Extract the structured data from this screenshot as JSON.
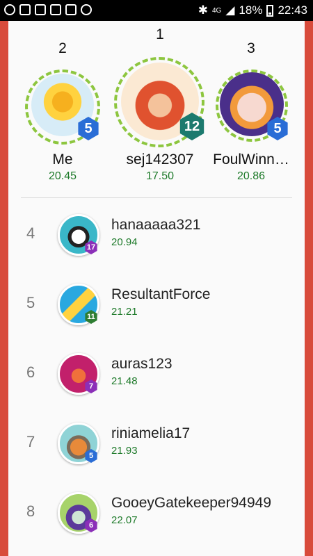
{
  "status_bar": {
    "battery": "18%",
    "time": "22:43",
    "network": "4G"
  },
  "podium": [
    {
      "rank": "2",
      "name": "Me",
      "time": "20.45",
      "level": "5",
      "avatar": "sunflower-avatar",
      "badge_color": "#2a6dd6"
    },
    {
      "rank": "1",
      "name": "sej142307",
      "time": "17.50",
      "level": "12",
      "avatar": "queen-of-clubs-avatar",
      "badge_color": "#1c7a6e"
    },
    {
      "rank": "3",
      "name": "FoulWinn…",
      "time": "20.86",
      "level": "5",
      "avatar": "unicorn-avatar",
      "badge_color": "#2a6dd6"
    }
  ],
  "list": [
    {
      "rank": "4",
      "name": "hanaaaaa321",
      "time": "20.94",
      "level": "17",
      "avatar": "robot-avatar",
      "badge_color": "#8b2fb8"
    },
    {
      "rank": "5",
      "name": "ResultantForce",
      "time": "21.21",
      "level": "11",
      "avatar": "paper-plane-avatar",
      "badge_color": "#2e7d32"
    },
    {
      "rank": "6",
      "name": "auras123",
      "time": "21.48",
      "level": "7",
      "avatar": "jar-monster-avatar",
      "badge_color": "#8b2fb8"
    },
    {
      "rank": "7",
      "name": "riniamelia17",
      "time": "21.93",
      "level": "5",
      "avatar": "viking-avatar",
      "badge_color": "#2a6dd6"
    },
    {
      "rank": "8",
      "name": "GooeyGatekeeper94949",
      "time": "22.07",
      "level": "6",
      "avatar": "witch-avatar",
      "badge_color": "#8b2fb8"
    }
  ]
}
